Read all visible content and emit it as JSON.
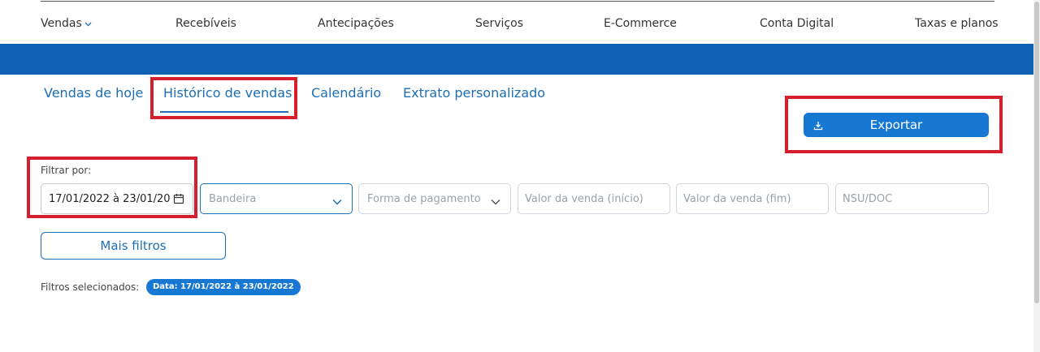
{
  "nav": {
    "items": [
      {
        "label": "Vendas"
      },
      {
        "label": "Recebíveis"
      },
      {
        "label": "Antecipações"
      },
      {
        "label": "Serviços"
      },
      {
        "label": "E-Commerce"
      },
      {
        "label": "Conta Digital"
      },
      {
        "label": "Taxas e planos"
      }
    ]
  },
  "tabs": [
    {
      "label": "Vendas de hoje"
    },
    {
      "label": "Histórico de vendas",
      "active": true
    },
    {
      "label": "Calendário"
    },
    {
      "label": "Extrato personalizado"
    }
  ],
  "export": {
    "label": "Exportar",
    "icon": "download-icon"
  },
  "filters": {
    "label": "Filtrar por:",
    "date_value": "17/01/2022 à 23/01/20",
    "bandeira_placeholder": "Bandeira",
    "forma_pagamento_placeholder": "Forma de pagamento",
    "valor_inicio_placeholder": "Valor da venda (início)",
    "valor_fim_placeholder": "Valor da venda (fim)",
    "nsu_placeholder": "NSU/DOC"
  },
  "more_filters": {
    "label": "Mais filtros"
  },
  "selected_filters": {
    "label": "Filtros selecionados:",
    "chip": "Data: 17/01/2022 à 23/01/2022"
  },
  "colors": {
    "brand_blue": "#0f62b3",
    "accent_blue": "#1778d3",
    "link_blue": "#1c6fb5",
    "highlight_red": "#d61f2c"
  }
}
